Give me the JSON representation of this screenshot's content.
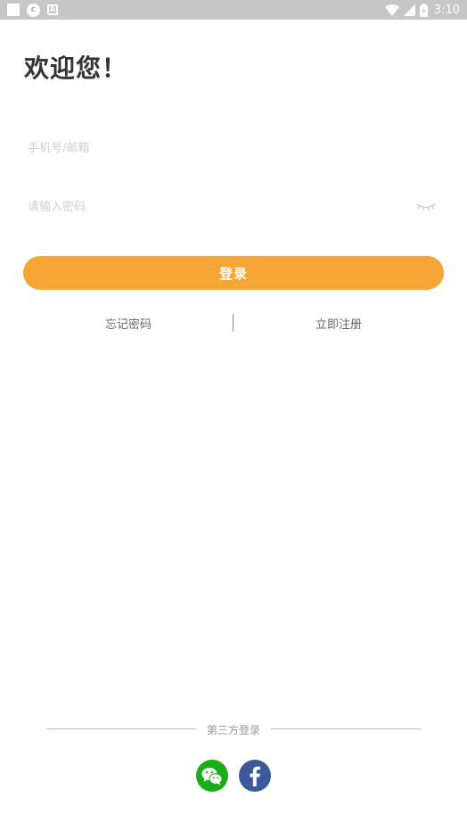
{
  "status_bar": {
    "left_icons": [
      "square-notification-icon",
      "game-controller-icon",
      "a-app-icon"
    ],
    "circle_glyph": "C",
    "a_glyph": "A",
    "right_icons": [
      "wifi-icon",
      "cellular-signal-icon",
      "battery-icon"
    ],
    "time": "3:10"
  },
  "header": {
    "title": "欢迎您！"
  },
  "form": {
    "phone_placeholder": "手机号/邮箱",
    "phone_value": "",
    "password_placeholder": "请输入密码",
    "password_value": "",
    "password_toggle_icon": "eye-closed-icon"
  },
  "actions": {
    "login_label": "登录",
    "login_color": "#f5a534",
    "forgot_label": "忘记密码",
    "register_label": "立即注册"
  },
  "third_party": {
    "label": "第三方登录",
    "providers": [
      {
        "icon": "wechat-icon",
        "color": "#1aad19"
      },
      {
        "icon": "facebook-icon",
        "color": "#3b5a9a"
      }
    ]
  }
}
